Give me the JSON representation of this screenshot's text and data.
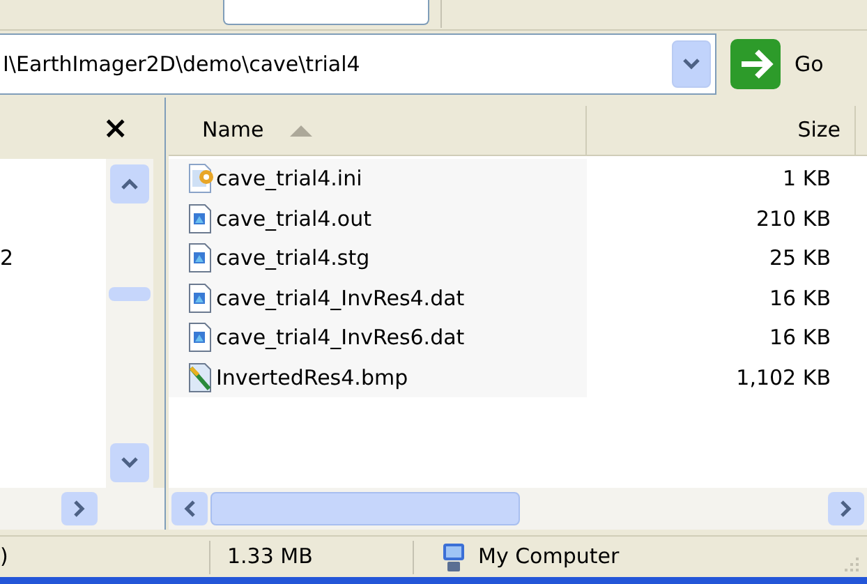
{
  "address_bar": {
    "value": "I\\EarthImager2D\\demo\\cave\\trial4",
    "go_label": "Go"
  },
  "folders_pane": {
    "close_label": "×",
    "item_fragment": "2"
  },
  "columns": [
    {
      "label": "Name",
      "sorted": true
    },
    {
      "label": "Size",
      "sorted": false
    }
  ],
  "files": [
    {
      "name": "cave_trial4.ini",
      "size": "1 KB",
      "kind": "settings"
    },
    {
      "name": "cave_trial4.out",
      "size": "210 KB",
      "kind": "document"
    },
    {
      "name": "cave_trial4.stg",
      "size": "25 KB",
      "kind": "document"
    },
    {
      "name": "cave_trial4_InvRes4.dat",
      "size": "16 KB",
      "kind": "document"
    },
    {
      "name": "cave_trial4_InvRes6.dat",
      "size": "16 KB",
      "kind": "document"
    },
    {
      "name": "InvertedRes4.bmp",
      "size": "1,102 KB",
      "kind": "image"
    }
  ],
  "status_bar": {
    "objects_fragment": ")",
    "size": "1.33 MB",
    "location": "My Computer"
  }
}
